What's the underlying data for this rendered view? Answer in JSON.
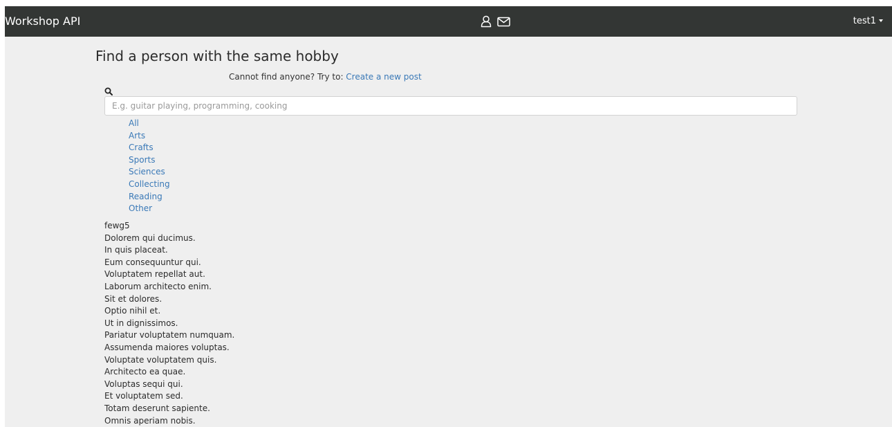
{
  "navbar": {
    "brand": "Workshop API",
    "icons": [
      "user-icon",
      "envelope-icon"
    ],
    "user": "test1"
  },
  "page": {
    "title": "Find a person with the same hobby",
    "hint_prefix": "Cannot find anyone? Try to: ",
    "hint_link": "Create a new post"
  },
  "search": {
    "value": "",
    "placeholder": "E.g. guitar playing, programming, cooking"
  },
  "categories": [
    "All",
    "Arts",
    "Crafts",
    "Sports",
    "Sciences",
    "Collecting",
    "Reading",
    "Other"
  ],
  "results": [
    "fewg5",
    "Dolorem qui ducimus.",
    "In quis placeat.",
    "Eum consequuntur qui.",
    "Voluptatem repellat aut.",
    "Laborum architecto enim.",
    "Sit et dolores.",
    "Optio nihil et.",
    "Ut in dignissimos.",
    "Pariatur voluptatem numquam.",
    "Assumenda maiores voluptas.",
    "Voluptate voluptatem quis.",
    "Architecto ea quae.",
    "Voluptas sequi qui.",
    "Et voluptatem sed.",
    "Totam deserunt sapiente.",
    "Omnis aperiam nobis."
  ],
  "colors": {
    "navbar_bg": "#333634",
    "page_bg": "#efefef",
    "link": "#3a79b7"
  }
}
